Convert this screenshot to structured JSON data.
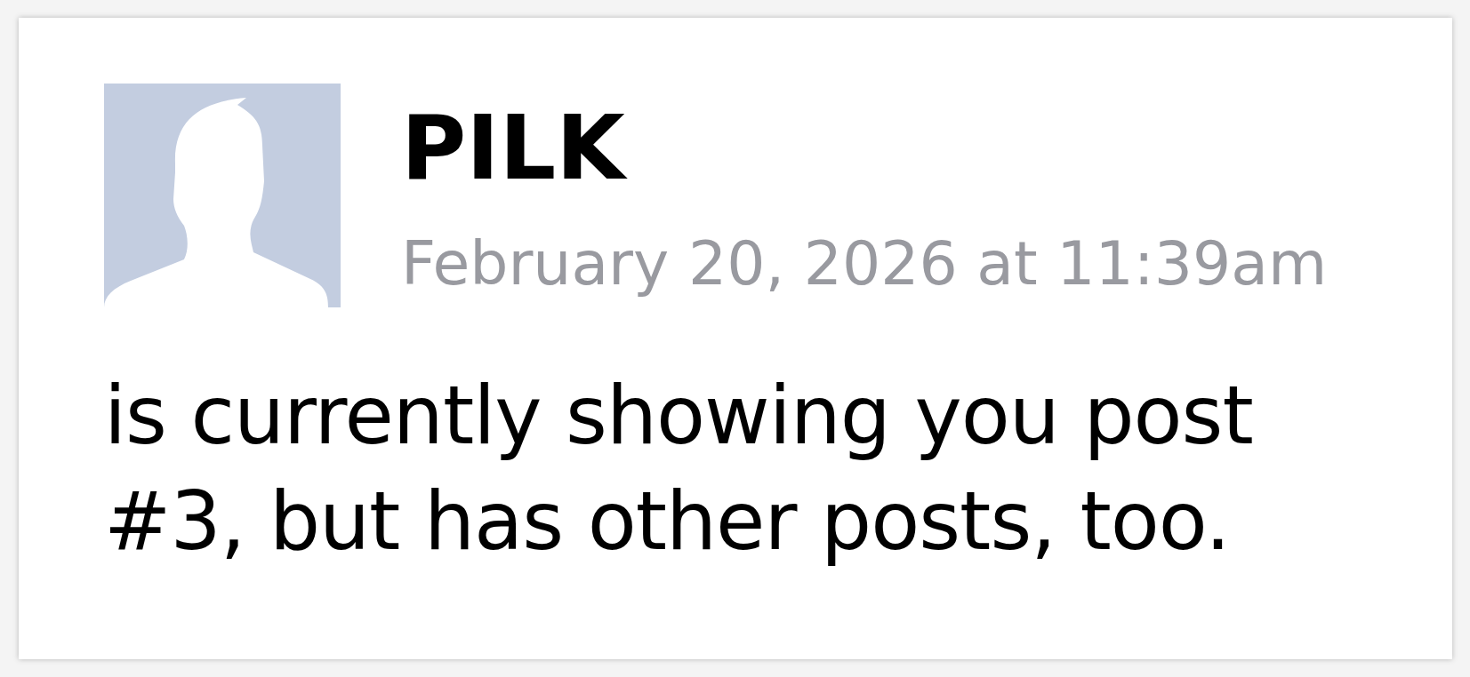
{
  "post": {
    "author": "PILK",
    "timestamp": "February 20, 2026 at 11:39am",
    "body": "is currently showing you post #3, but has other posts, too."
  }
}
